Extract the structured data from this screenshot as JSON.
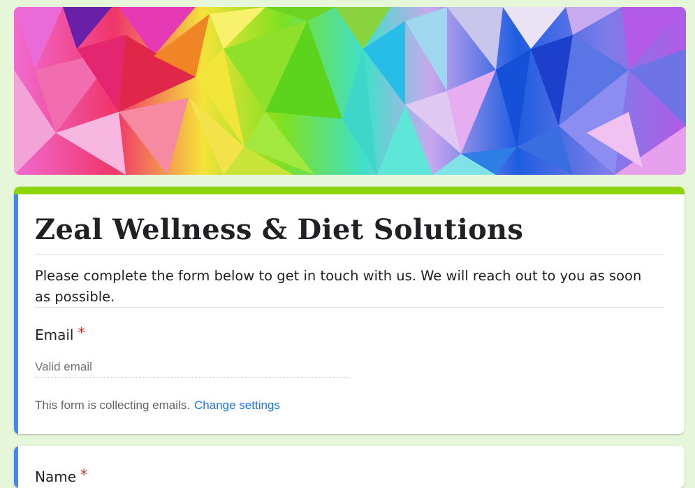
{
  "header": {
    "banner_image": "colorful-low-poly-geometric-banner"
  },
  "form": {
    "title": "Zeal Wellness & Diet Solutions",
    "description": "Please complete the form below to get in touch with us. We will reach out to you as soon as possible.",
    "accent_color": "#8ed40a",
    "focus_color": "#4285f4"
  },
  "email_question": {
    "label": "Email",
    "required_mark": "*",
    "placeholder": "Valid email",
    "collecting_note": "This form is collecting emails.",
    "change_settings": "Change settings"
  },
  "name_question": {
    "label": "Name",
    "required_mark": "*"
  },
  "colors": {
    "background": "#e6f6d8",
    "required": "#d93025",
    "link": "#1a73e8"
  }
}
